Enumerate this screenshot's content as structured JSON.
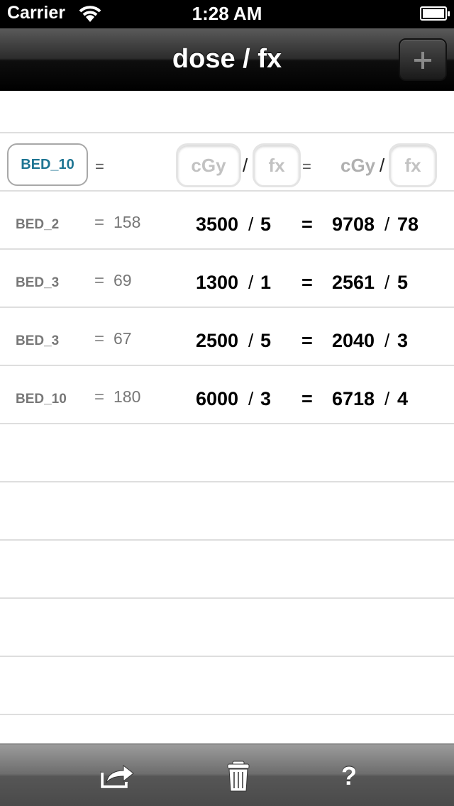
{
  "status_bar": {
    "carrier": "Carrier",
    "time": "1:28 AM"
  },
  "nav": {
    "title": "dose / fx",
    "add_icon": "plus-icon"
  },
  "input_row": {
    "bed_type": "BED_10",
    "equals": "=",
    "dose_placeholder": "cGy",
    "fx_placeholder": "fx",
    "slash": "/",
    "result_equals": "=",
    "result_unit": "cGy",
    "result_fx_placeholder": "fx"
  },
  "rows": [
    {
      "bed": "BED_2",
      "eq": "=",
      "value": "158",
      "dose": "3500",
      "fx": "5",
      "eq2": "=",
      "eq_dose": "9708",
      "eq_fx": "78"
    },
    {
      "bed": "BED_3",
      "eq": "=",
      "value": "69",
      "dose": "1300",
      "fx": "1",
      "eq2": "=",
      "eq_dose": "2561",
      "eq_fx": "5"
    },
    {
      "bed": "BED_3",
      "eq": "=",
      "value": "67",
      "dose": "2500",
      "fx": "5",
      "eq2": "=",
      "eq_dose": "2040",
      "eq_fx": "3"
    },
    {
      "bed": "BED_10",
      "eq": "=",
      "value": "180",
      "dose": "6000",
      "fx": "3",
      "eq2": "=",
      "eq_dose": "6718",
      "eq_fx": "4"
    }
  ],
  "toolbar": {
    "share_icon": "share-icon",
    "trash_icon": "trash-icon",
    "help_label": "?"
  }
}
